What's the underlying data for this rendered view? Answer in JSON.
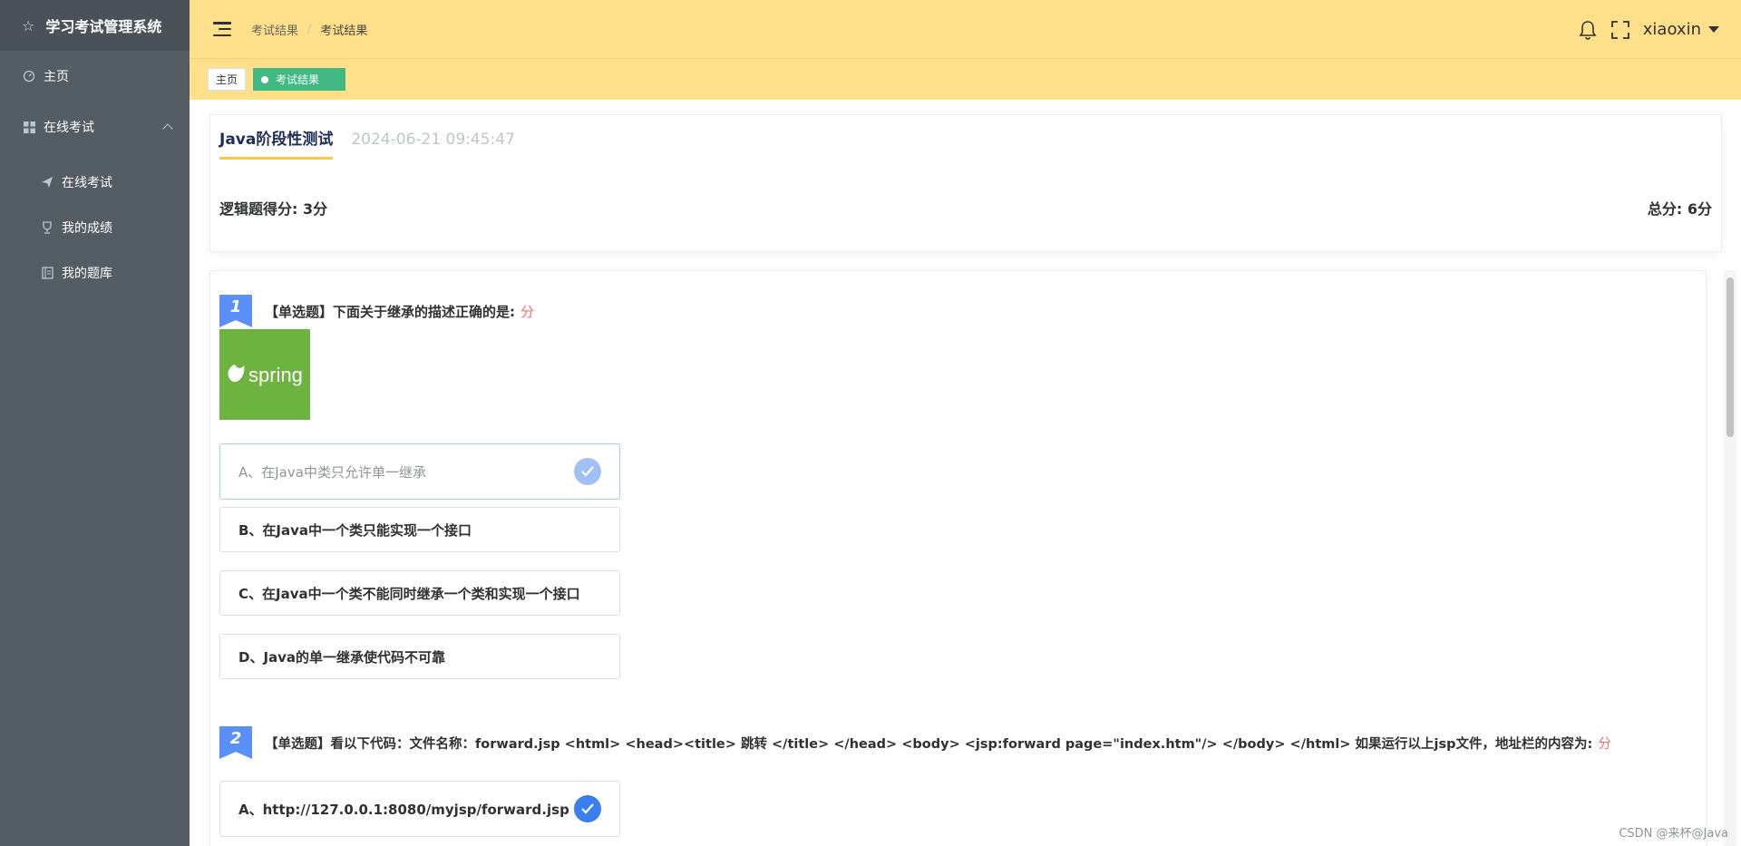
{
  "app": {
    "title": "学习考试管理系统"
  },
  "sidebar": {
    "home": "主页",
    "group": "在线考试",
    "items": [
      {
        "label": "在线考试",
        "icon": "paper-plane-icon"
      },
      {
        "label": "我的成绩",
        "icon": "trophy-icon"
      },
      {
        "label": "我的题库",
        "icon": "notebook-icon"
      }
    ]
  },
  "header": {
    "breadcrumb": [
      "考试结果",
      "考试结果"
    ],
    "username": "xiaoxin"
  },
  "tags": {
    "home": "主页",
    "active": "考试结果"
  },
  "exam": {
    "title": "Java阶段性测试",
    "time": "2024-06-21 09:45:47",
    "logic_score": "逻辑题得分: 3分",
    "total_score": "总分: 6分"
  },
  "questions": [
    {
      "number": "1",
      "text": "【单选题】下面关于继承的描述正确的是:",
      "score_label": "分",
      "image_text": "spring",
      "options": [
        "A、在Java中类只允许单一继承",
        "B、在Java中一个类只能实现一个接口",
        "C、在Java中一个类不能同时继承一个类和实现一个接口",
        "D、Java的单一继承使代码不可靠"
      ],
      "selected": "A"
    },
    {
      "number": "2",
      "text": "【单选题】看以下代码：文件名称：forward.jsp <html> <head><title> 跳转 </title> </head> <body> <jsp:forward page=\"index.htm\"/> </body> </html> 如果运行以上jsp文件，地址栏的内容为:",
      "score_label": "分",
      "options": [
        "A、http://127.0.0.1:8080/myjsp/forward.jsp"
      ],
      "selected": "A"
    }
  ],
  "watermark": "CSDN @来杯@Java",
  "colors": {
    "header_bg": "#ffe08a",
    "sidebar_bg": "#545c64",
    "accent_green": "#42b983",
    "qnum_blue": "#5b8ff9",
    "score_red": "#f56c6c"
  }
}
